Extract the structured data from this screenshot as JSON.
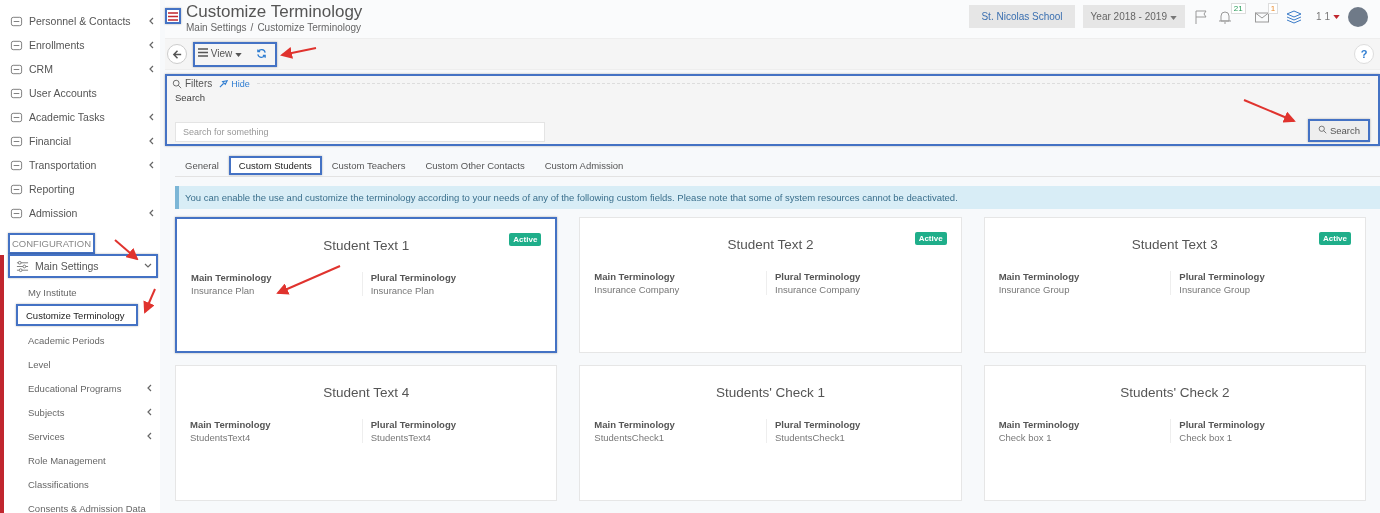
{
  "sidebar": {
    "items": [
      {
        "label": "Personnel & Contacts",
        "has_submenu": true
      },
      {
        "label": "Enrollments",
        "has_submenu": true
      },
      {
        "label": "CRM",
        "has_submenu": true
      },
      {
        "label": "User Accounts",
        "has_submenu": false
      },
      {
        "label": "Academic Tasks",
        "has_submenu": true
      },
      {
        "label": "Financial",
        "has_submenu": true
      },
      {
        "label": "Transportation",
        "has_submenu": true
      },
      {
        "label": "Reporting",
        "has_submenu": false
      },
      {
        "label": "Admission",
        "has_submenu": true
      }
    ],
    "section": {
      "label": "CONFIGURATION",
      "highlighted": true
    },
    "group": {
      "label": "Main Settings",
      "expanded": true,
      "highlighted": true,
      "children": [
        {
          "label": "My Institute",
          "selected": false,
          "highlighted": false,
          "has_submenu": false
        },
        {
          "label": "Customize Terminology",
          "selected": true,
          "highlighted": true,
          "has_submenu": false
        },
        {
          "label": "Academic Periods",
          "selected": false,
          "highlighted": false,
          "has_submenu": false
        },
        {
          "label": "Level",
          "selected": false,
          "highlighted": false,
          "has_submenu": false
        },
        {
          "label": "Educational Programs",
          "selected": false,
          "highlighted": false,
          "has_submenu": true
        },
        {
          "label": "Subjects",
          "selected": false,
          "highlighted": false,
          "has_submenu": true
        },
        {
          "label": "Services",
          "selected": false,
          "highlighted": false,
          "has_submenu": true
        },
        {
          "label": "Role Management",
          "selected": false,
          "highlighted": false,
          "has_submenu": false
        },
        {
          "label": "Classifications",
          "selected": false,
          "highlighted": false,
          "has_submenu": false
        },
        {
          "label": "Consents & Admission Data",
          "selected": false,
          "highlighted": false,
          "has_submenu": false
        }
      ]
    }
  },
  "header": {
    "title": "Customize Terminology",
    "breadcrumb": [
      "Main Settings",
      "Customize Terminology"
    ],
    "breadcrumb_separator": "/",
    "menu_highlighted": true,
    "school": "St. Nicolas School",
    "year": "Year 2018 - 2019",
    "notifications": "21",
    "messages": "1",
    "user": "1 1"
  },
  "toolbar": {
    "view": "View",
    "highlighted": true,
    "help": "?"
  },
  "filters": {
    "title": "Filters",
    "hide": "Hide",
    "search_label": "Search",
    "placeholder": "Search for something",
    "button": "Search",
    "highlighted": true,
    "button_highlighted": true
  },
  "tabs": [
    {
      "label": "General",
      "selected": false,
      "highlighted": false
    },
    {
      "label": "Custom Students",
      "selected": true,
      "highlighted": true
    },
    {
      "label": "Custom Teachers",
      "selected": false,
      "highlighted": false
    },
    {
      "label": "Custom Other Contacts",
      "selected": false,
      "highlighted": false
    },
    {
      "label": "Custom Admission",
      "selected": false,
      "highlighted": false
    }
  ],
  "notice": "You can enable the use and customize the terminology according to your needs of any of the following custom fields. Please note that some of system resources cannot be deactivated.",
  "cards": [
    {
      "title": "Student Text 1",
      "active": true,
      "status": "Active",
      "highlighted": true,
      "main_label": "Main Terminology",
      "main_value": "Insurance Plan",
      "plural_label": "Plural Terminology",
      "plural_value": "Insurance Plan"
    },
    {
      "title": "Student Text 2",
      "active": true,
      "status": "Active",
      "highlighted": false,
      "main_label": "Main Terminology",
      "main_value": "Insurance Company",
      "plural_label": "Plural Terminology",
      "plural_value": "Insurance Company"
    },
    {
      "title": "Student Text 3",
      "active": true,
      "status": "Active",
      "highlighted": false,
      "main_label": "Main Terminology",
      "main_value": "Insurance Group",
      "plural_label": "Plural Terminology",
      "plural_value": "Insurance Group"
    },
    {
      "title": "Student Text 4",
      "active": false,
      "highlighted": false,
      "main_label": "Main Terminology",
      "main_value": "StudentsText4",
      "plural_label": "Plural Terminology",
      "plural_value": "StudentsText4"
    },
    {
      "title": "Students' Check 1",
      "active": false,
      "highlighted": false,
      "main_label": "Main Terminology",
      "main_value": "StudentsCheck1",
      "plural_label": "Plural Terminology",
      "plural_value": "StudentsCheck1"
    },
    {
      "title": "Students' Check 2",
      "active": false,
      "highlighted": false,
      "main_label": "Main Terminology",
      "main_value": "Check box 1",
      "plural_label": "Plural Terminology",
      "plural_value": "Check box 1"
    }
  ]
}
